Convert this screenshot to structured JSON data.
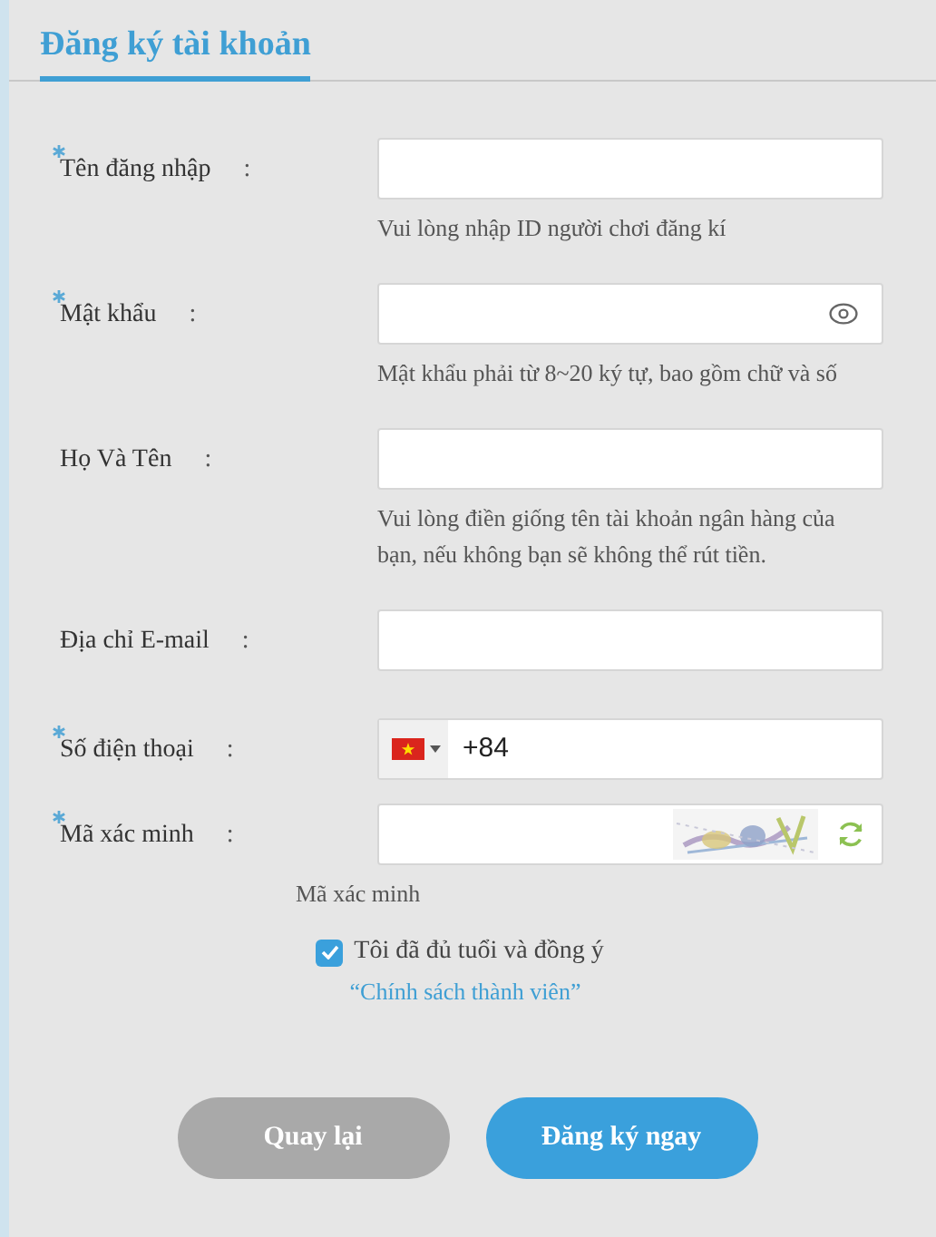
{
  "title": "Đăng ký tài khoản",
  "fields": [
    {
      "kind": "username",
      "label": "Tên đăng nhập",
      "colon": ":",
      "required": true,
      "hint": "Vui lòng nhập ID người chơi đăng kí"
    },
    {
      "kind": "password",
      "label": "Mật khẩu",
      "colon": ":",
      "required": true,
      "hint": "Mật khẩu phải từ 8~20 ký tự, bao gồm chữ và số"
    },
    {
      "kind": "name",
      "label": "Họ Và Tên",
      "colon": ":",
      "required": false,
      "hint": "Vui lòng điền giống tên tài khoản ngân hàng của bạn, nếu không bạn sẽ không thể rút tiền."
    },
    {
      "kind": "email",
      "label": "Địa chỉ E-mail",
      "colon": ":",
      "required": false
    },
    {
      "kind": "phone",
      "label": "Số điện thoại",
      "colon": ":",
      "required": true,
      "value": "+84"
    },
    {
      "kind": "captcha",
      "label": "Mã xác minh",
      "colon": ":",
      "required": true,
      "hint": "Mã xác minh"
    }
  ],
  "agreement": {
    "checked": true,
    "text": "Tôi đã đủ tuổi và đồng ý",
    "link": "“Chính sách thành viên”"
  },
  "buttons": [
    {
      "kind": "back",
      "label": "Quay lại"
    },
    {
      "kind": "submit",
      "label": "Đăng ký ngay"
    }
  ]
}
